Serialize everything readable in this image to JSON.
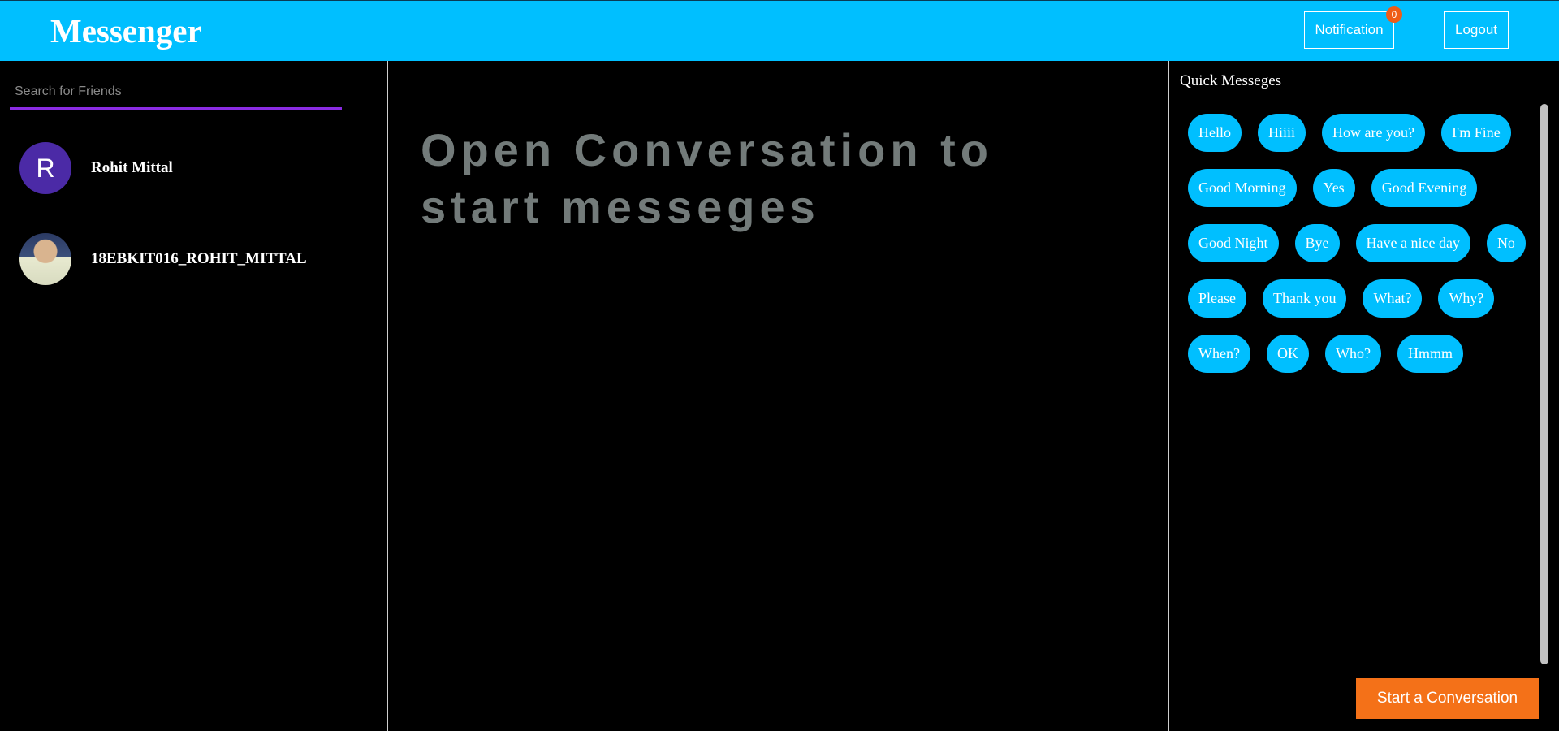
{
  "header": {
    "brand": "Messenger",
    "notification_label": "Notification",
    "notification_count": "0",
    "logout_label": "Logout",
    "colors": {
      "bar": "#00bfff",
      "badge": "#ef5c17"
    }
  },
  "sidebar": {
    "search": {
      "placeholder": "Search for Friends",
      "value": ""
    },
    "friends": [
      {
        "name": "Rohit Mittal",
        "avatar_letter": "R",
        "avatar_type": "letter"
      },
      {
        "name": "18EBKIT016_ROHIT_MITTAL",
        "avatar_letter": "",
        "avatar_type": "photo"
      }
    ]
  },
  "main": {
    "empty_message": "Open Conversation to start messeges"
  },
  "quick": {
    "title": "Quick Messeges",
    "messages": [
      "Hello",
      "Hiiii",
      "How are you?",
      "I'm Fine",
      "Good Morning",
      "Yes",
      "Good Evening",
      "Good Night",
      "Bye",
      "Have a nice day",
      "No",
      "Please",
      "Thank you",
      "What?",
      "Why?",
      "When?",
      "OK",
      "Who?",
      "Hmmm"
    ],
    "start_button": "Start a Conversation",
    "colors": {
      "chip": "#00bfff",
      "start": "#f47118"
    }
  }
}
